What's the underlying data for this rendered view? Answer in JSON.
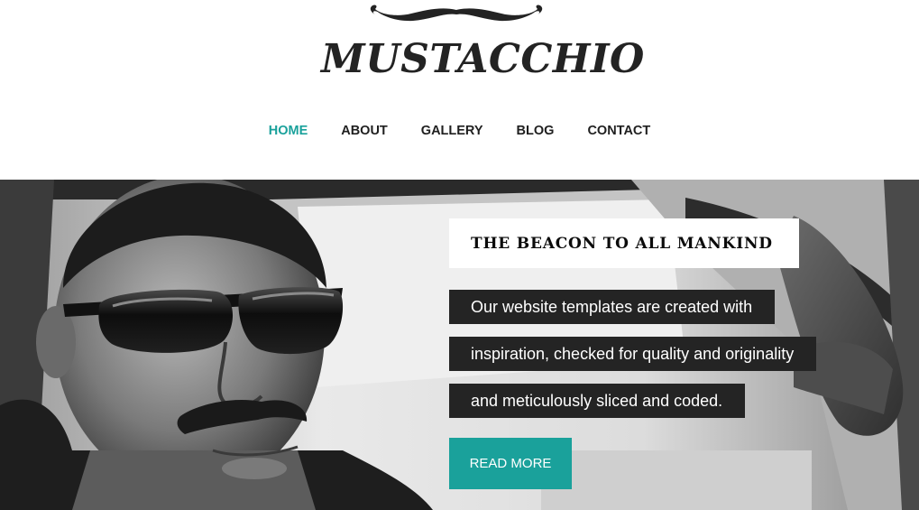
{
  "brand": {
    "name": "MUSTACCHIO",
    "logo_icon": "mustache-icon",
    "text_color": "#232323"
  },
  "nav": {
    "items": [
      {
        "label": "HOME",
        "active": true
      },
      {
        "label": "ABOUT",
        "active": false
      },
      {
        "label": "GALLERY",
        "active": false
      },
      {
        "label": "BLOG",
        "active": false
      },
      {
        "label": "CONTACT",
        "active": false
      }
    ],
    "active_color": "#1aa19b",
    "text_color": "#1f1f1f"
  },
  "hero": {
    "title": "THE BEACON TO ALL MANKIND",
    "lines": [
      "Our website templates are created with",
      "inspiration, checked for quality and originality",
      "and meticulously sliced and coded."
    ],
    "button_label": "READ MORE",
    "button_color": "#1aa19b",
    "text_box_color": "#242424",
    "photo": "black-and-white photo of a man with sunglasses and a mustache driving a car"
  }
}
